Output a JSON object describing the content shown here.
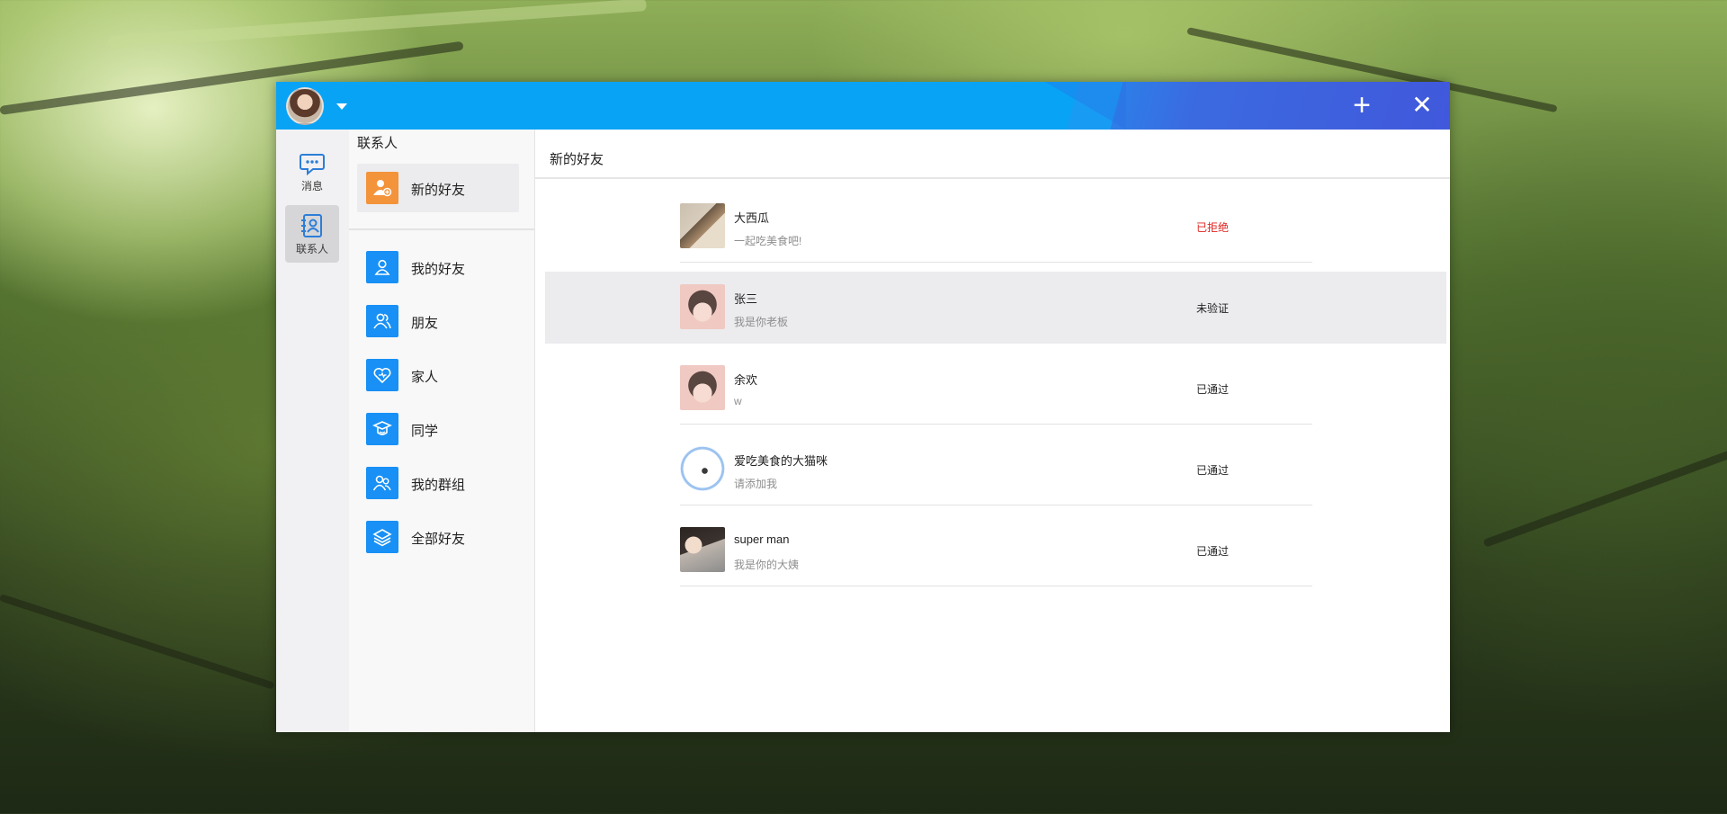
{
  "titlebar": {
    "user_avatar": "user-avatar",
    "dropdown_icon": "caret-down-icon",
    "add_label": "+",
    "close_label": "✕"
  },
  "sidebar": {
    "items": [
      {
        "label": "消息",
        "icon": "message-icon",
        "active": false
      },
      {
        "label": "联系人",
        "icon": "contacts-icon",
        "active": true
      }
    ]
  },
  "contacts": {
    "title": "联系人",
    "new_friend": {
      "label": "新的好友",
      "icon": "add-user-icon"
    },
    "groups": [
      {
        "label": "我的好友",
        "icon": "user-icon"
      },
      {
        "label": "朋友",
        "icon": "friends-icon"
      },
      {
        "label": "家人",
        "icon": "heart-icon"
      },
      {
        "label": "同学",
        "icon": "graduation-cap-icon"
      },
      {
        "label": "我的群组",
        "icon": "group-icon"
      },
      {
        "label": "全部好友",
        "icon": "layers-icon"
      }
    ]
  },
  "main": {
    "title": "新的好友",
    "requests": [
      {
        "name": "大西瓜",
        "message": "一起吃美食吧!",
        "status": "已拒绝",
        "status_color": "#e0221d"
      },
      {
        "name": "张三",
        "message": "我是你老板",
        "status": "未验证",
        "status_color": "#222222"
      },
      {
        "name": "余欢",
        "message": "w",
        "status": "已通过",
        "status_color": "#222222"
      },
      {
        "name": "爱吃美食的大猫咪",
        "message": "请添加我",
        "status": "已通过",
        "status_color": "#222222"
      },
      {
        "name": "super man",
        "message": "我是你的大姨",
        "status": "已通过",
        "status_color": "#222222"
      }
    ]
  },
  "colors": {
    "titlebar": "#09a3f6",
    "accent_blue": "#1890f5",
    "accent_orange": "#f3933a",
    "rejected": "#e0221d"
  }
}
